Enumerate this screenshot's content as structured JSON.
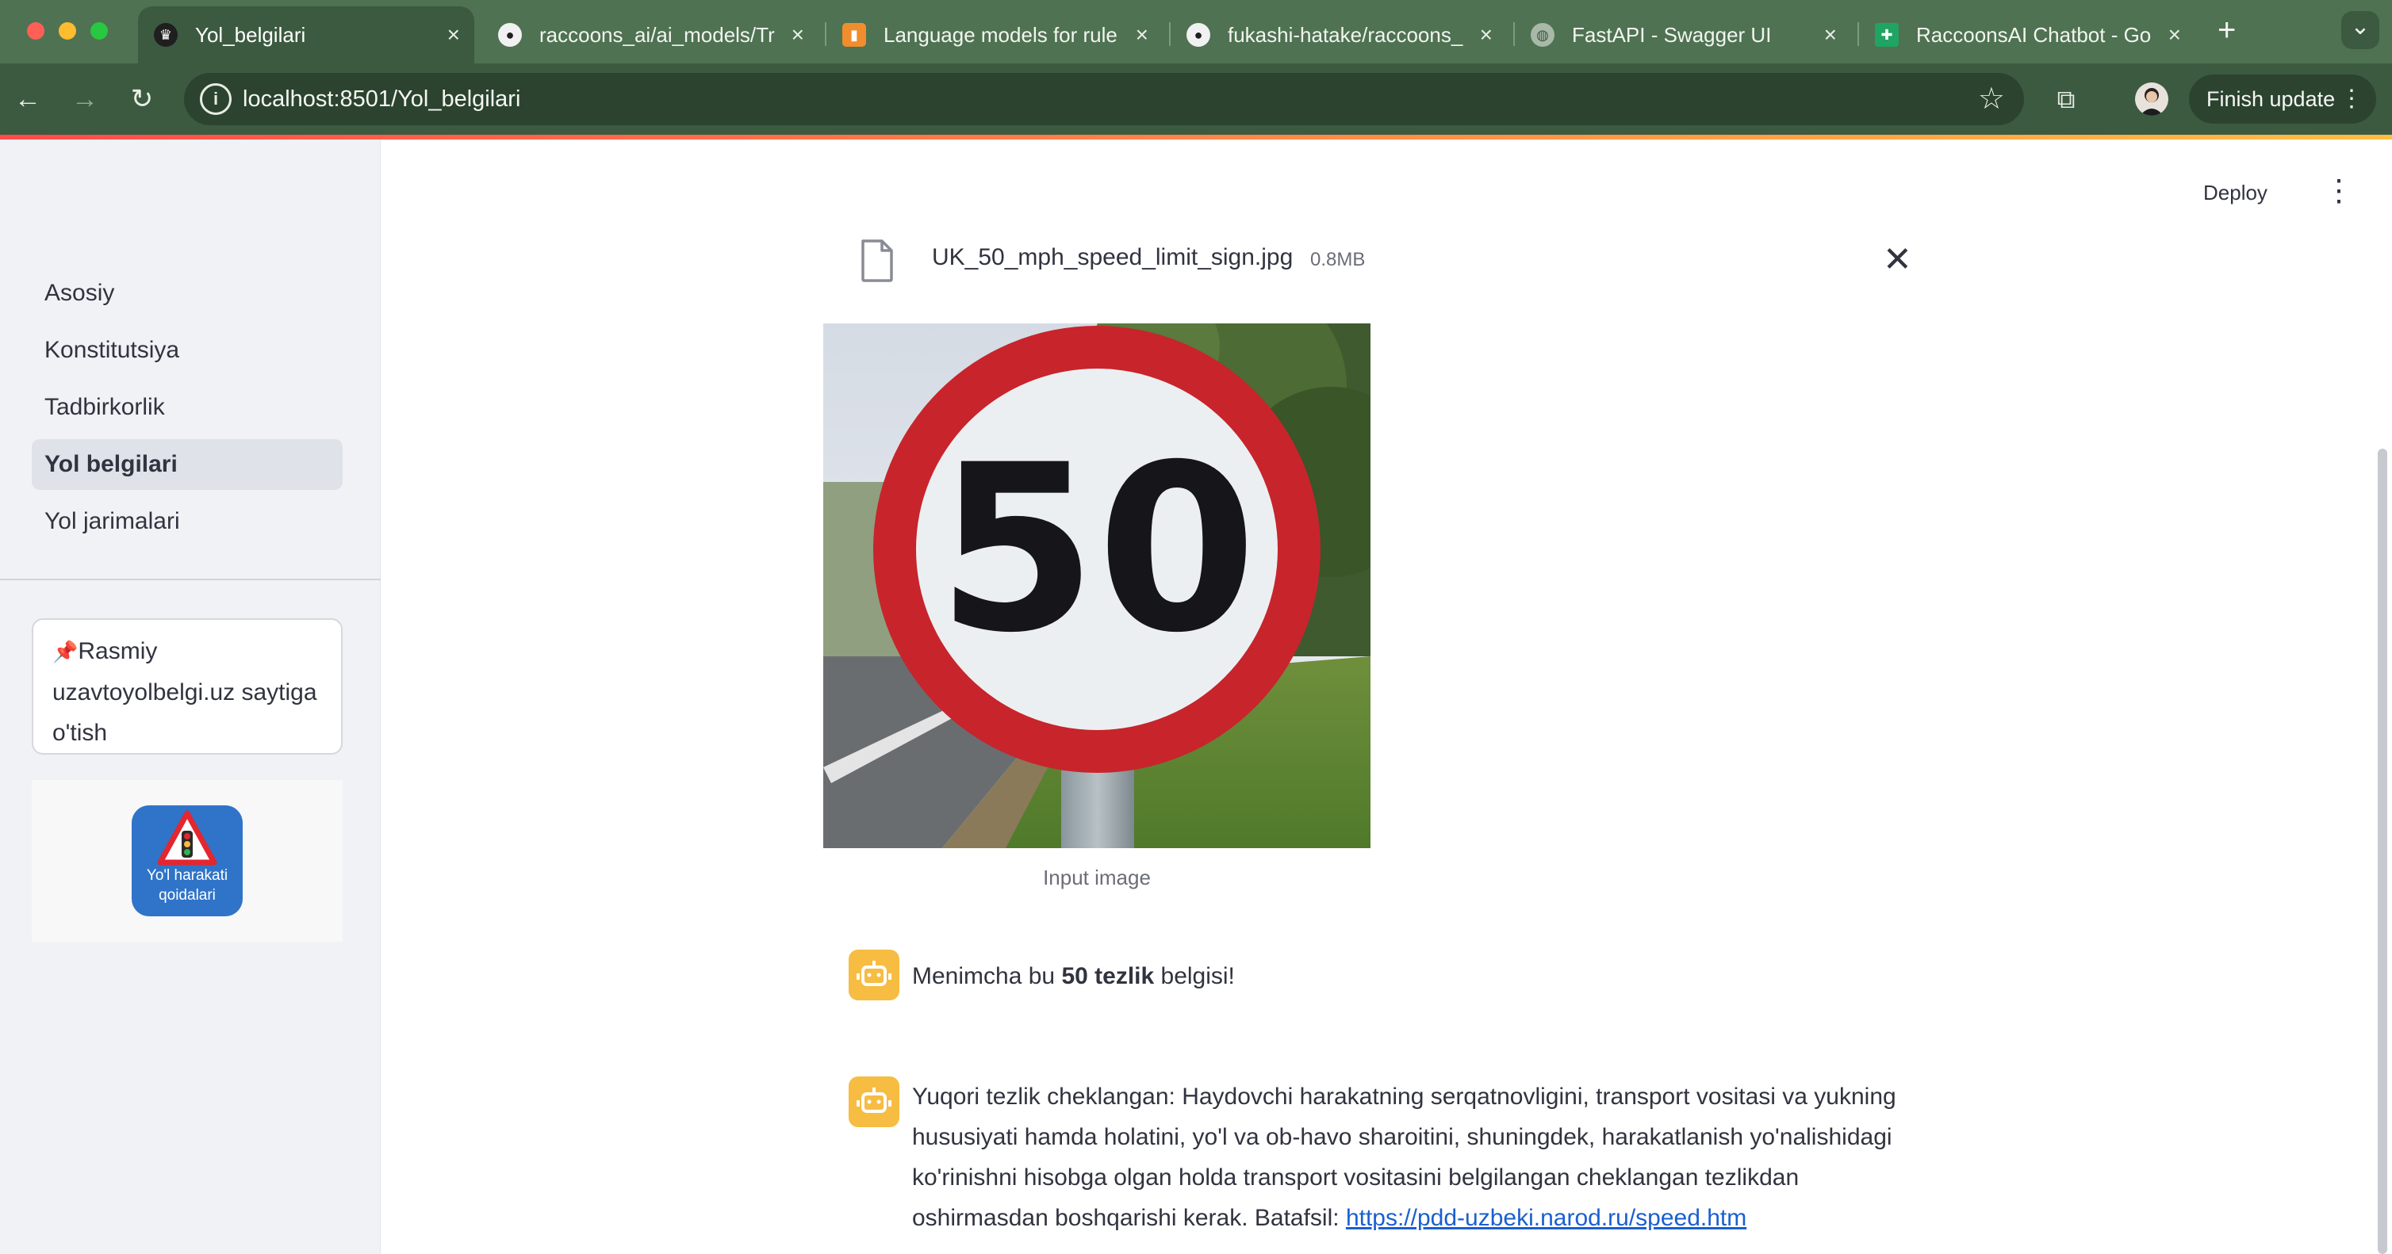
{
  "browser": {
    "tabs": [
      {
        "title": "Yol_belgilari",
        "active": true,
        "icon": "crown-icon"
      },
      {
        "title": "raccoons_ai/ai_models/Tr",
        "active": false,
        "icon": "github-icon"
      },
      {
        "title": "Language models for rule",
        "active": false,
        "icon": "book-icon"
      },
      {
        "title": "fukashi-hatake/raccoons_",
        "active": false,
        "icon": "github-icon"
      },
      {
        "title": "FastAPI - Swagger UI",
        "active": false,
        "icon": "globe-icon"
      },
      {
        "title": "RaccoonsAI Chatbot - Go",
        "active": false,
        "icon": "sheets-icon"
      }
    ],
    "new_tab": "+",
    "tab_menu": "⌄",
    "url": "localhost:8501/Yol_belgilari",
    "finish_update": "Finish update"
  },
  "sidebar": {
    "items": [
      {
        "label": "Asosiy",
        "active": false
      },
      {
        "label": "Konstitutsiya",
        "active": false
      },
      {
        "label": "Tadbirkorlik",
        "active": false
      },
      {
        "label": "Yol belgilari",
        "active": true
      },
      {
        "label": "Yol jarimalari",
        "active": false
      }
    ],
    "link_card": {
      "pin": "📌",
      "text": "Rasmiy uzavtoyolbelgi.uz saytiga o'tish"
    },
    "logo_caption": "Yo'l harakati qoidalari"
  },
  "header": {
    "deploy": "Deploy",
    "menu": "⋮"
  },
  "upload": {
    "file_name": "UK_50_mph_speed_limit_sign.jpg",
    "file_size": "0.8MB",
    "close": "✕"
  },
  "image": {
    "sign_text": "50",
    "caption": "Input image"
  },
  "messages": [
    {
      "prefix": "Menimcha bu ",
      "bold": "50 tezlik",
      "suffix": " belgisi!"
    },
    {
      "lines": [
        "Yuqori tezlik cheklangan: Haydovchi harakatning serqatnovligini, transport vositasi va yukning",
        "hususiyati hamda holatini, yo'l va ob-havo sharoitini, shuningdek, harakatlanish yo'nalishidagi",
        "ko'rinishni hisobga olgan holda transport vositasini belgilangan cheklangan tezlikdan"
      ],
      "last_line_text": "oshirmasdan boshqarishi kerak. Batafsil: ",
      "link": "https://pdd-uzbeki.narod.ru/speed.htm"
    }
  ],
  "colors": {
    "chrome_green": "#4f7252",
    "accent_red": "#ff4b4b",
    "bot_avatar": "#f7bc42",
    "link": "#1a5fd0"
  }
}
